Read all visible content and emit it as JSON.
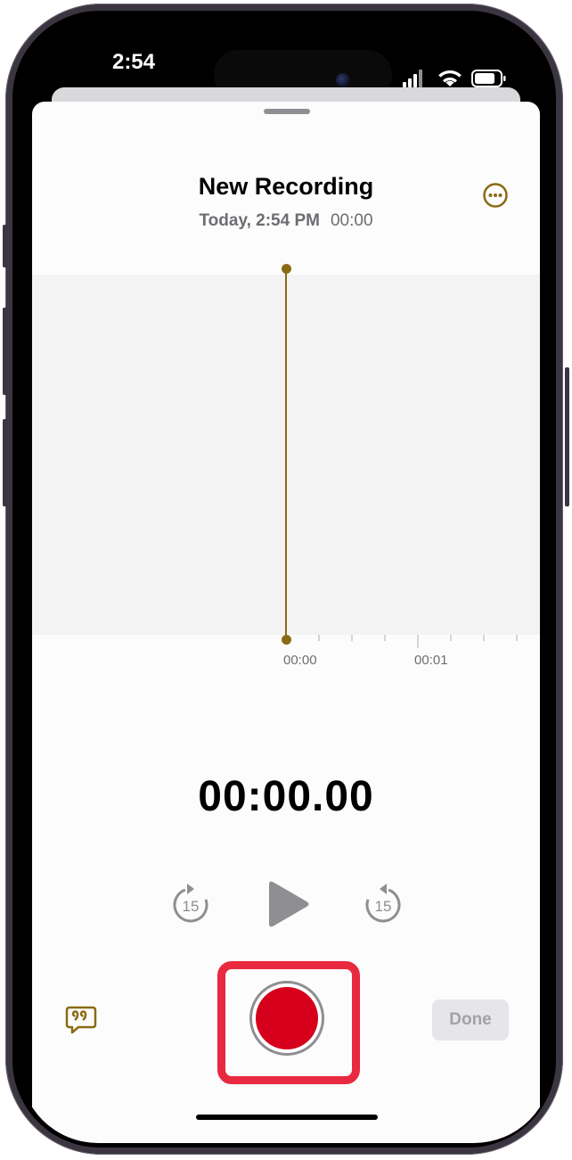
{
  "status_bar": {
    "time": "2:54"
  },
  "recording": {
    "title": "New Recording",
    "date": "Today, 2:54 PM",
    "duration": "00:00"
  },
  "waveform": {
    "tick_labels": [
      "00:00",
      "00:01"
    ]
  },
  "timer": "00:00.00",
  "controls": {
    "skip_back_seconds": "15",
    "skip_forward_seconds": "15"
  },
  "done_label": "Done",
  "colors": {
    "accent": "#8b6a15",
    "record_red": "#d6001c",
    "highlight_red": "#e8293f"
  },
  "icons": [
    "more-ellipsis-icon",
    "skip-back-15-icon",
    "play-icon",
    "skip-forward-15-icon",
    "record-icon",
    "transcript-quote-icon",
    "cellular-signal-icon",
    "wifi-icon",
    "battery-icon"
  ]
}
